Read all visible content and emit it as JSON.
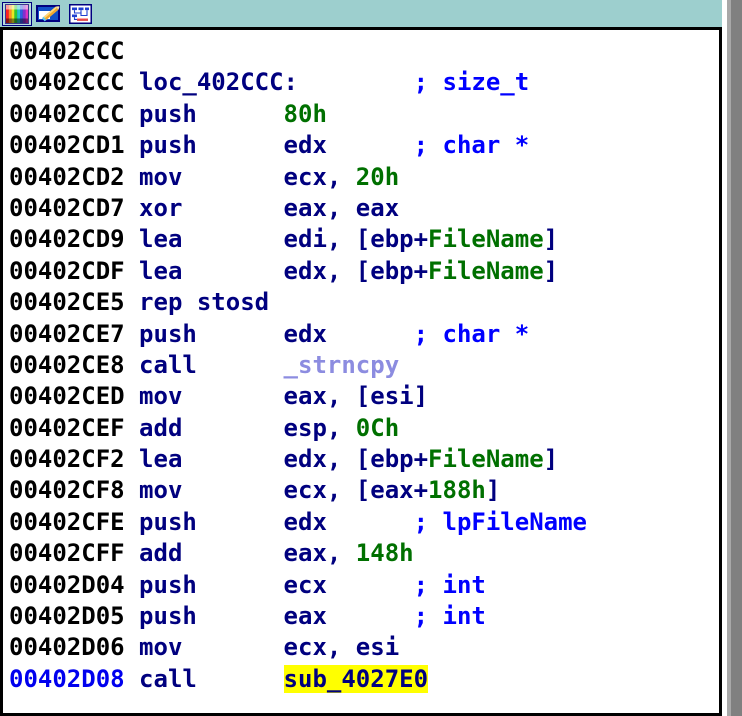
{
  "window": {
    "title": "",
    "background_color": "#ffffff",
    "titlebar_color": "#9dcfce",
    "border_color": "#000000"
  },
  "toolbar": {
    "buttons": [
      {
        "name": "color-palette-icon",
        "tooltip": "Colors",
        "pressed": true
      },
      {
        "name": "pencil-edit-icon",
        "tooltip": "Edit",
        "pressed": false
      },
      {
        "name": "graph-chart-icon",
        "tooltip": "Graph view",
        "pressed": false
      }
    ]
  },
  "colors": {
    "address": "#000000",
    "address_current": "#0000ee",
    "mnemonic": "#00007f",
    "operand": "#00007f",
    "number": "#007000",
    "local_name": "#007000",
    "label": "#00007f",
    "comment": "#0000ff",
    "external_function": "#8c8ce0",
    "highlight_background": "#ffff00"
  },
  "disassembly": {
    "lines": [
      {
        "address": "00402CCC",
        "address_style": "normal",
        "mnemonic": "",
        "operands": [],
        "comment": ""
      },
      {
        "address": "00402CCC",
        "address_style": "normal",
        "label": "loc_402CCC:",
        "comment": "; size_t"
      },
      {
        "address": "00402CCC",
        "address_style": "normal",
        "mnemonic": "push",
        "operands": [
          {
            "text": "80h",
            "type": "number"
          }
        ],
        "comment": ""
      },
      {
        "address": "00402CD1",
        "address_style": "normal",
        "mnemonic": "push",
        "operands": [
          {
            "text": "edx",
            "type": "register"
          }
        ],
        "comment": "; char *"
      },
      {
        "address": "00402CD2",
        "address_style": "normal",
        "mnemonic": "mov",
        "operands": [
          {
            "text": "ecx, ",
            "type": "register"
          },
          {
            "text": "20h",
            "type": "number"
          }
        ],
        "comment": ""
      },
      {
        "address": "00402CD7",
        "address_style": "normal",
        "mnemonic": "xor",
        "operands": [
          {
            "text": "eax, eax",
            "type": "register"
          }
        ],
        "comment": ""
      },
      {
        "address": "00402CD9",
        "address_style": "normal",
        "mnemonic": "lea",
        "operands": [
          {
            "text": "edi, [ebp+",
            "type": "register"
          },
          {
            "text": "FileName",
            "type": "name"
          },
          {
            "text": "]",
            "type": "register"
          }
        ],
        "comment": ""
      },
      {
        "address": "00402CDF",
        "address_style": "normal",
        "mnemonic": "lea",
        "operands": [
          {
            "text": "edx, [ebp+",
            "type": "register"
          },
          {
            "text": "FileName",
            "type": "name"
          },
          {
            "text": "]",
            "type": "register"
          }
        ],
        "comment": ""
      },
      {
        "address": "00402CE5",
        "address_style": "normal",
        "mnemonic": "rep stosd",
        "operands": [],
        "comment": ""
      },
      {
        "address": "00402CE7",
        "address_style": "normal",
        "mnemonic": "push",
        "operands": [
          {
            "text": "edx",
            "type": "register"
          }
        ],
        "comment": "; char *"
      },
      {
        "address": "00402CE8",
        "address_style": "normal",
        "mnemonic": "call",
        "operands": [
          {
            "text": "_strncpy",
            "type": "external"
          }
        ],
        "comment": ""
      },
      {
        "address": "00402CED",
        "address_style": "normal",
        "mnemonic": "mov",
        "operands": [
          {
            "text": "eax, [esi]",
            "type": "register"
          }
        ],
        "comment": ""
      },
      {
        "address": "00402CEF",
        "address_style": "normal",
        "mnemonic": "add",
        "operands": [
          {
            "text": "esp, ",
            "type": "register"
          },
          {
            "text": "0Ch",
            "type": "number"
          }
        ],
        "comment": ""
      },
      {
        "address": "00402CF2",
        "address_style": "normal",
        "mnemonic": "lea",
        "operands": [
          {
            "text": "edx, [ebp+",
            "type": "register"
          },
          {
            "text": "FileName",
            "type": "name"
          },
          {
            "text": "]",
            "type": "register"
          }
        ],
        "comment": ""
      },
      {
        "address": "00402CF8",
        "address_style": "normal",
        "mnemonic": "mov",
        "operands": [
          {
            "text": "ecx, [eax+",
            "type": "register"
          },
          {
            "text": "188h",
            "type": "number"
          },
          {
            "text": "]",
            "type": "register"
          }
        ],
        "comment": ""
      },
      {
        "address": "00402CFE",
        "address_style": "normal",
        "mnemonic": "push",
        "operands": [
          {
            "text": "edx",
            "type": "register"
          }
        ],
        "comment": "; lpFileName"
      },
      {
        "address": "00402CFF",
        "address_style": "normal",
        "mnemonic": "add",
        "operands": [
          {
            "text": "eax, ",
            "type": "register"
          },
          {
            "text": "148h",
            "type": "number"
          }
        ],
        "comment": ""
      },
      {
        "address": "00402D04",
        "address_style": "normal",
        "mnemonic": "push",
        "operands": [
          {
            "text": "ecx",
            "type": "register"
          }
        ],
        "comment": "; int"
      },
      {
        "address": "00402D05",
        "address_style": "normal",
        "mnemonic": "push",
        "operands": [
          {
            "text": "eax",
            "type": "register"
          }
        ],
        "comment": "; int"
      },
      {
        "address": "00402D06",
        "address_style": "normal",
        "mnemonic": "mov",
        "operands": [
          {
            "text": "ecx, esi",
            "type": "register"
          }
        ],
        "comment": ""
      },
      {
        "address": "00402D08",
        "address_style": "current",
        "mnemonic": "call",
        "operands": [
          {
            "text": "sub_4027E0",
            "type": "highlighted"
          }
        ],
        "comment": ""
      }
    ]
  }
}
